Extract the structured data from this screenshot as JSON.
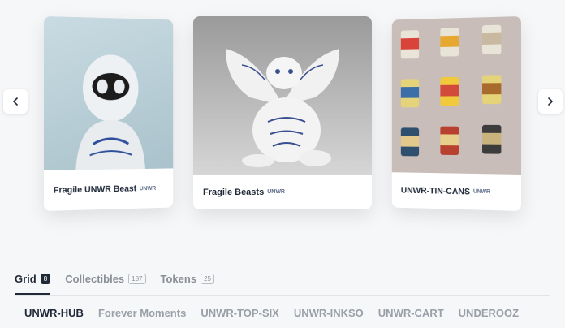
{
  "carousel": {
    "cards": [
      {
        "name": "Fragile UNWR Beast",
        "tag": "UNWR"
      },
      {
        "name": "Fragile Beasts",
        "tag": "UNWR"
      },
      {
        "name": "UNWR-TIN-CANS",
        "tag": "UNWR"
      }
    ],
    "prev_icon": "chevron-left-icon",
    "next_icon": "chevron-right-icon"
  },
  "tabs": [
    {
      "label": "Grid",
      "count": "8",
      "active": true
    },
    {
      "label": "Collectibles",
      "count": "187",
      "active": false
    },
    {
      "label": "Tokens",
      "count": "25",
      "active": false
    }
  ],
  "subtabs": [
    {
      "label": "UNWR-HUB",
      "active": true
    },
    {
      "label": "Forever Moments",
      "active": false
    },
    {
      "label": "UNWR-TOP-SIX",
      "active": false
    },
    {
      "label": "UNWR-INKSO",
      "active": false
    },
    {
      "label": "UNWR-CART",
      "active": false
    },
    {
      "label": "UNDEROOZ",
      "active": false
    }
  ]
}
